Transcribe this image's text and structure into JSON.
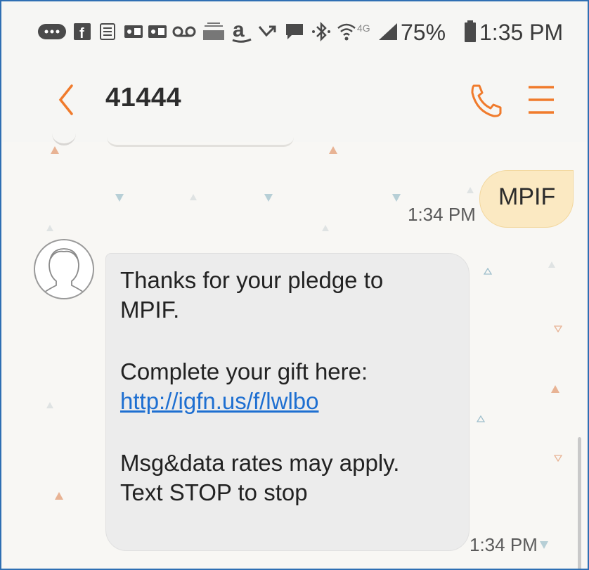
{
  "status_bar": {
    "battery": "75%",
    "time": "1:35 PM",
    "network": "4G",
    "icons": [
      "more-icon",
      "facebook-icon",
      "news-icon",
      "outlook-icon",
      "outlook-icon-2",
      "voicemail-icon",
      "amazon-dash-icon",
      "amazon-icon",
      "missed-call-icon",
      "message-icon",
      "bluetooth-icon",
      "wifi-icon",
      "signal-icon",
      "battery-icon"
    ]
  },
  "header": {
    "title": "41444",
    "accent_color": "#f07b2c"
  },
  "conversation": {
    "outgoing": {
      "text": "MPIF",
      "time": "1:34 PM"
    },
    "incoming": {
      "line1": "Thanks for your pledge to",
      "line2": "MPIF.",
      "line3": "Complete your gift here:",
      "link": "http://igfn.us/f/lwlbo",
      "line4": "Msg&data rates may apply.",
      "line5": "Text STOP to stop",
      "time": "1:34 PM"
    }
  }
}
